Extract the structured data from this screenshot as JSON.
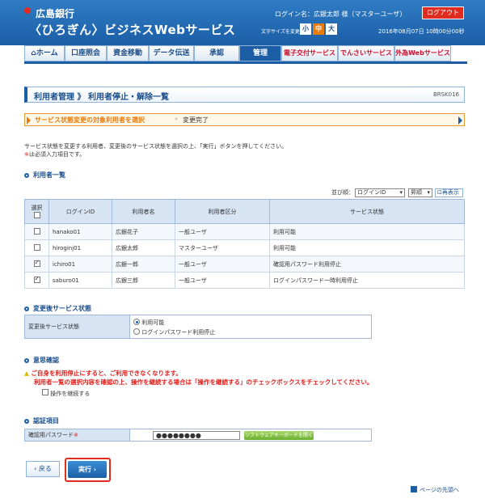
{
  "header": {
    "bank": "広島銀行",
    "service": "〈ひろぎん〉ビジネスWebサービス",
    "login_name": "ログイン名：広銀太郎 様（マスターユーザ）",
    "logout": "ログアウト",
    "font_size_label": "文字サイズを変更",
    "font_small": "小",
    "font_medium": "中",
    "font_large": "大",
    "datetime": "2016年08月07日 10時00分00秒"
  },
  "nav": {
    "items": [
      "ホーム",
      "口座照会",
      "資金移動",
      "データ伝送",
      "承認",
      "管理",
      "電子交付サービス",
      "でんさいサービス",
      "外為Webサービス"
    ]
  },
  "page": {
    "title": "利用者管理 》 利用者停止・解除一覧",
    "screen_id": "BRSK016"
  },
  "steps": {
    "current": "サービス状態変更の対象利用者を選択",
    "next": "変更完了"
  },
  "instructions": {
    "line1": "サービス状態を変更する利用者、変更後のサービス状態を選択の上、「実行」ボタンを押してください。",
    "required_mark": "※",
    "line2": "は必須入力項目です。"
  },
  "users_section": {
    "title": "利用者一覧",
    "sort_label": "並び順：",
    "sort_field": "ログインID",
    "sort_order": "昇順",
    "redisplay": "再表示",
    "headers": [
      "選択",
      "ログインID",
      "利用者名",
      "利用者区分",
      "サービス状態"
    ],
    "rows": [
      {
        "checked": false,
        "login_id": "hanako01",
        "name": "広銀花子",
        "kind": "一般ユーザ",
        "status": "利用可能"
      },
      {
        "checked": false,
        "login_id": "hiroginj01",
        "name": "広銀太郎",
        "kind": "マスターユーザ",
        "status": "利用可能"
      },
      {
        "checked": true,
        "login_id": "ichiro01",
        "name": "広銀一郎",
        "kind": "一般ユーザ",
        "status": "確認用パスワード利用停止"
      },
      {
        "checked": true,
        "login_id": "saburo01",
        "name": "広銀三郎",
        "kind": "一般ユーザ",
        "status": "ログインパスワード一時利用停止"
      }
    ]
  },
  "change_section": {
    "title": "変更後サービス状態",
    "label": "変更後サービス状態",
    "option1": "利用可能",
    "option2": "ログインパスワード利用停止",
    "selected": 1
  },
  "confirm_section": {
    "title": "意思確認",
    "warning1": "ご自身を利用停止にすると、ご利用できなくなります。",
    "warning2": "利用者一覧の選択内容を確認の上、操作を継続する場合は「操作を継続する」のチェックボックスをチェックしてください。",
    "continue_label": "操作を継続する"
  },
  "auth_section": {
    "title": "認証項目",
    "label": "確認用パスワード",
    "required_mark": "※",
    "password_value": "●●●●●●●●",
    "keyboard_button": "ソフトウェアキーボードを開く"
  },
  "actions": {
    "back": "戻る",
    "execute": "実行",
    "to_top": "ページの先頭へ"
  },
  "colors": {
    "brand_blue": "#1b5ea6",
    "accent_red": "#e02b20",
    "step_orange": "#e97b0c"
  }
}
